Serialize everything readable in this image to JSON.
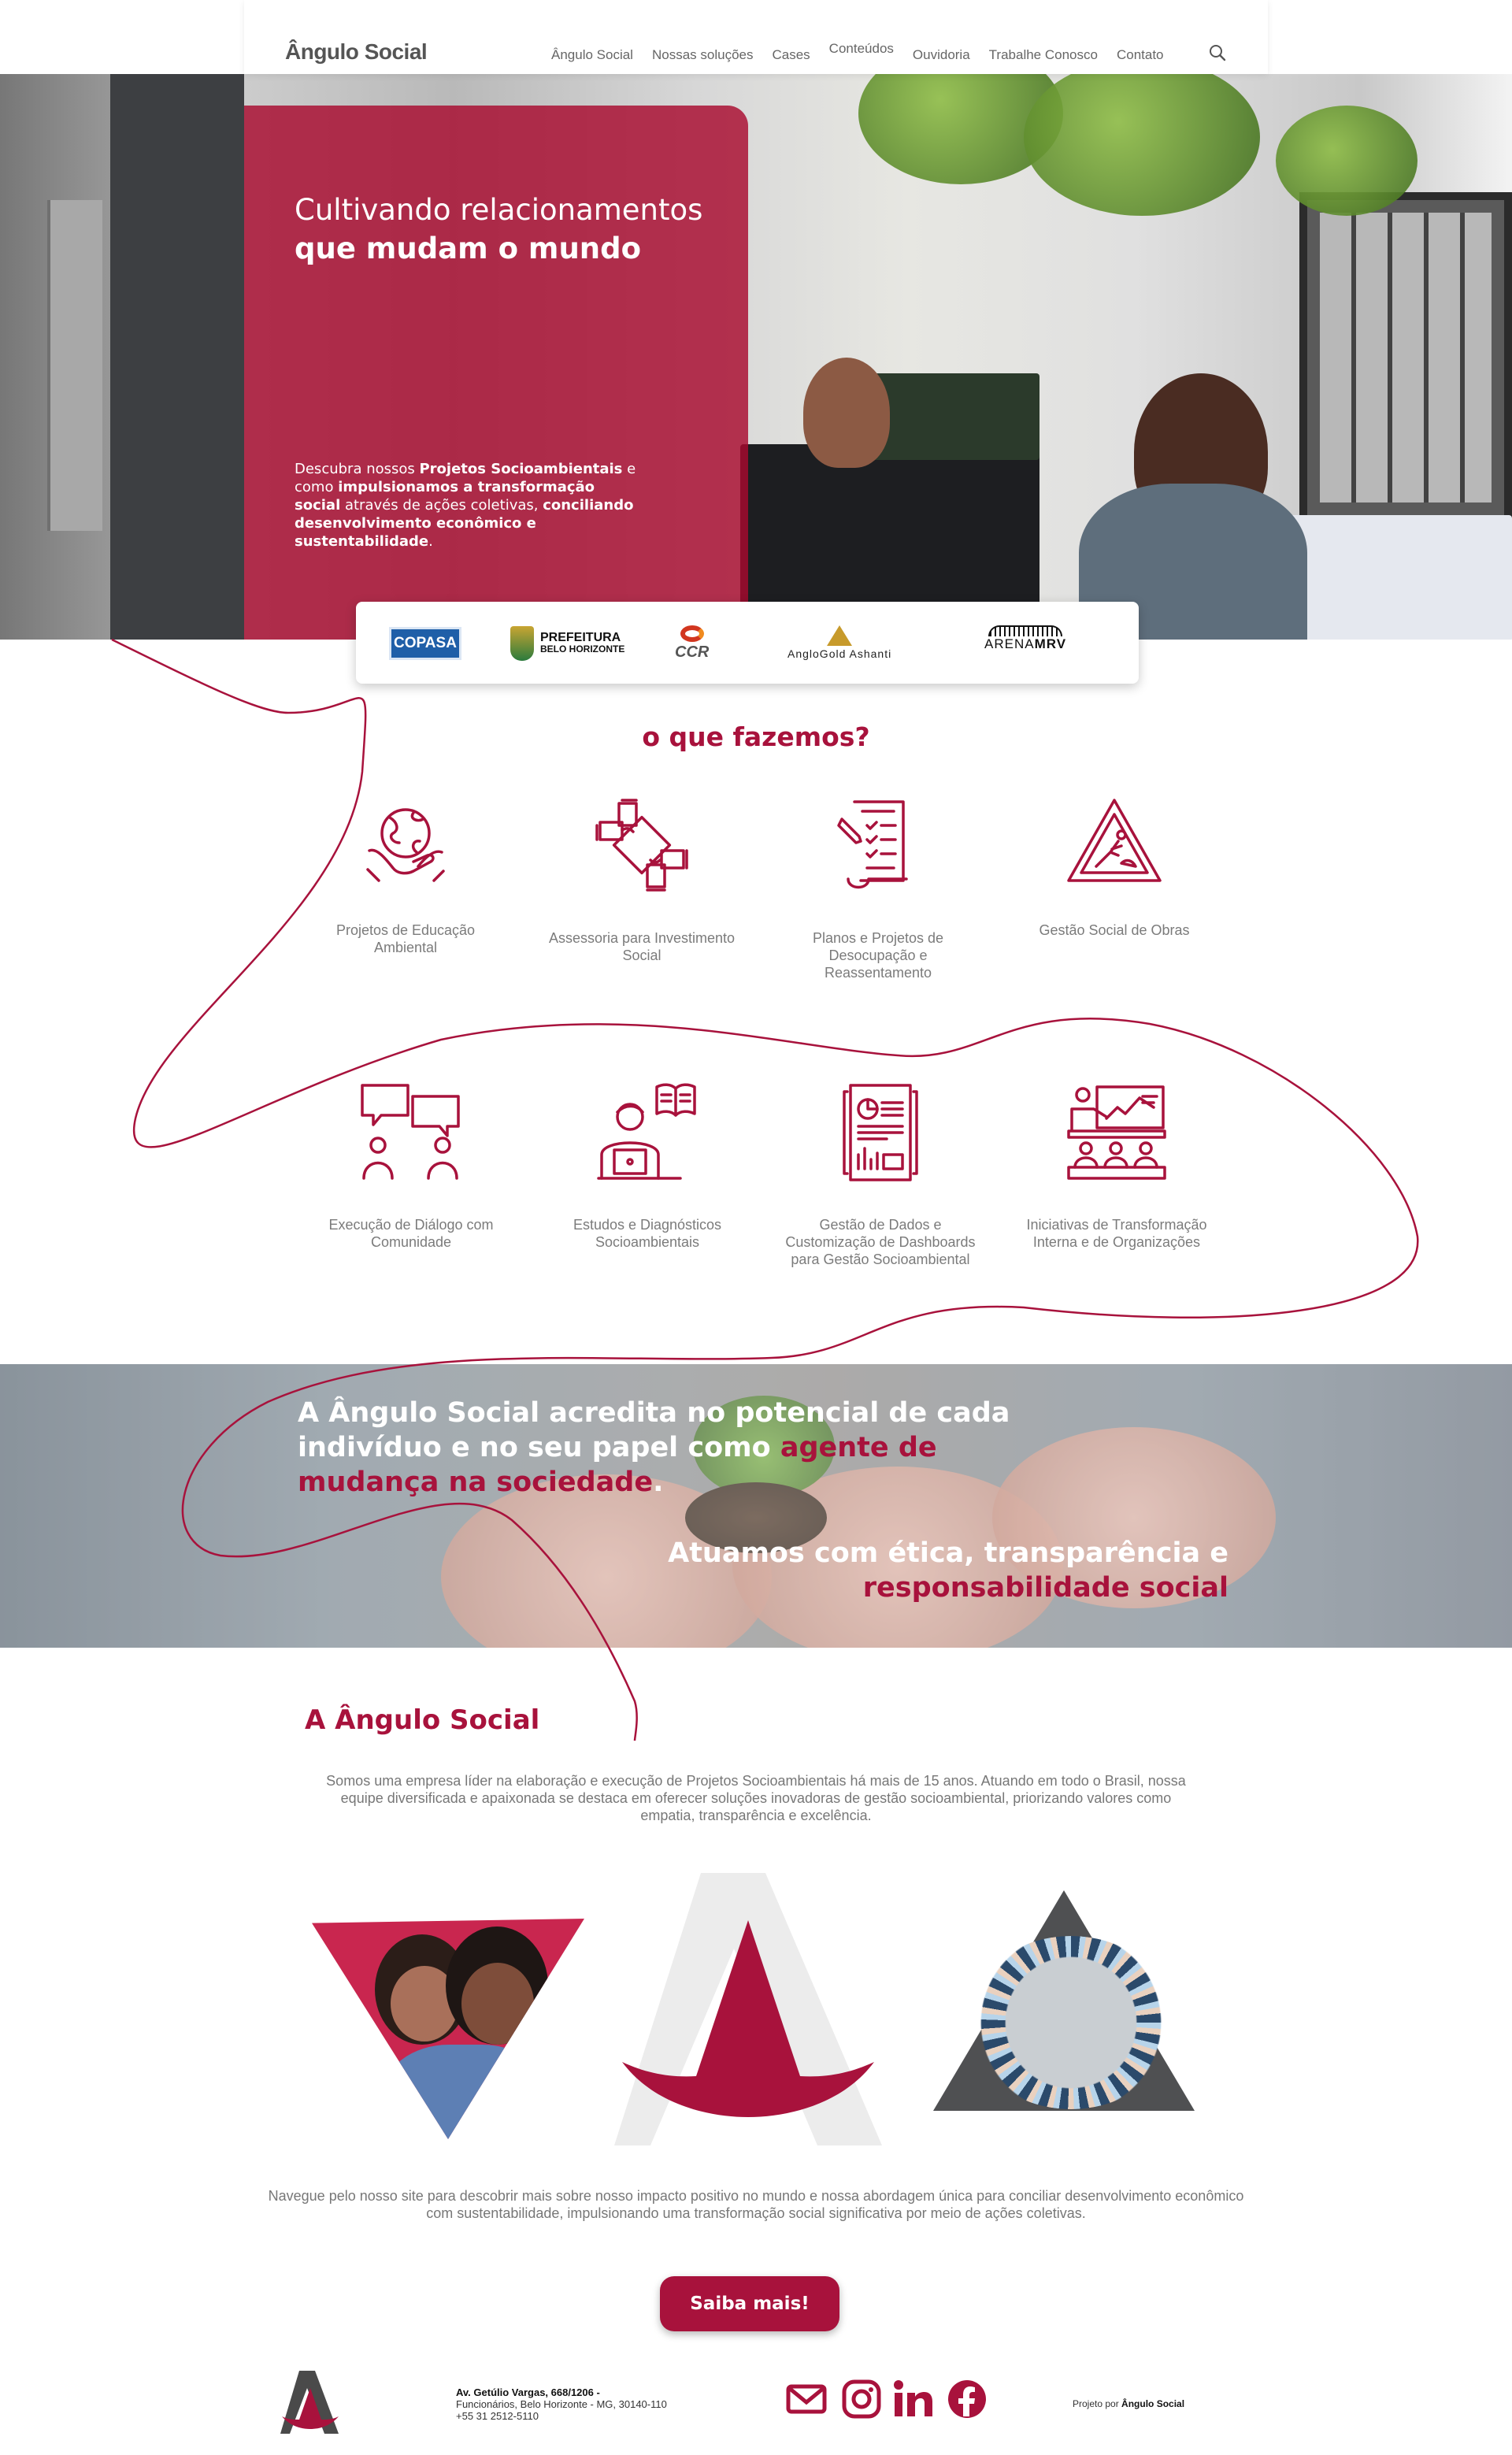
{
  "header": {
    "logo": "Ângulo Social",
    "nav": [
      "Ângulo Social",
      "Nossas soluções",
      "Cases",
      "Conteúdos",
      "Ouvidoria",
      "Trabalhe Conosco",
      "Contato"
    ]
  },
  "hero": {
    "title_regular": "Cultivando relacionamentos ",
    "title_bold": "que mudam o mundo",
    "desc_1": "Descubra nossos ",
    "desc_2": "Projetos Socioambientais",
    "desc_3": " e como ",
    "desc_4": "impulsionamos a transformação social",
    "desc_5": " através de ações coletivas, ",
    "desc_6": "conciliando desenvolvimento econômico e sustentabilidade",
    "desc_7": "."
  },
  "clients": {
    "copasa": "COPASA",
    "pbh_line1": "PREFEITURA",
    "pbh_line2": "BELO HORIZONTE",
    "ccr": "CCR",
    "anglo": "AngloGold Ashanti",
    "arena_1": "ARENA",
    "arena_2": "MRV"
  },
  "services": {
    "title": "o que fazemos?",
    "items": [
      {
        "label": "Projetos de Educação Ambiental",
        "icon": "globe-hands-icon"
      },
      {
        "label": "Assessoria para Investimento Social",
        "icon": "handshake-icon"
      },
      {
        "label": "Planos e Projetos de Desocupação e Reassentamento",
        "icon": "checklist-icon"
      },
      {
        "label": "Gestão Social de Obras",
        "icon": "construction-sign-icon"
      },
      {
        "label": "Execução de Diálogo com Comunidade",
        "icon": "dialogue-icon"
      },
      {
        "label": "Estudos e Diagnósticos Socioambientais",
        "icon": "study-icon"
      },
      {
        "label": "Gestão de Dados e Customização de Dashboards para Gestão Socioambiental",
        "icon": "dashboard-icon"
      },
      {
        "label": "Iniciativas de Transformação Interna e de Organizações",
        "icon": "presentation-icon"
      }
    ]
  },
  "belief": {
    "line1_a": "A Ângulo Social acredita no potencial de cada indivíduo e no seu papel como ",
    "line1_b": "agente de mudança na sociedade",
    "line1_c": ".",
    "line2_a": "Atuamos com ética, transparência e ",
    "line2_b": "responsabilidade social"
  },
  "about": {
    "title": "A Ângulo Social",
    "text": "Somos uma empresa líder na elaboração e execução de Projetos Socioambientais há mais de 15 anos. Atuando em todo o Brasil, nossa equipe diversificada e apaixonada se destaca em oferecer soluções inovadoras de gestão socioambiental, priorizando valores como empatia, transparência e excelência.",
    "navigate": "Navegue pelo nosso site para descobrir mais sobre nosso impacto positivo no mundo  e nossa abordagem única para conciliar desenvolvimento econômico com sustentabilidade, impulsionando uma transformação social significativa por meio de ações coletivas.",
    "cta": "Saiba mais!"
  },
  "footer": {
    "address_bold": "Av. Getúlio Vargas, 668/1206 -",
    "address_2": "Funcionários, Belo Horizonte - MG, 30140-110",
    "phone": "+55 31 2512-5110",
    "credit_prefix": "Projeto por ",
    "credit_name": "Ângulo Social"
  },
  "colors": {
    "brand": "#a8123c",
    "text": "#777777"
  }
}
